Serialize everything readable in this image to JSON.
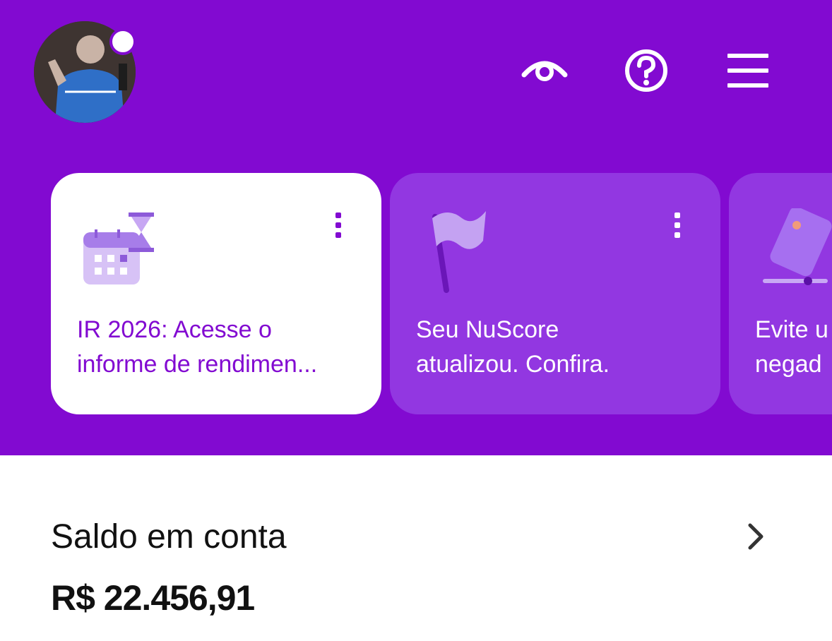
{
  "header": {
    "avatar_icon": "user-photo",
    "actions": [
      {
        "name": "eye-icon"
      },
      {
        "name": "help-icon"
      },
      {
        "name": "menu-icon"
      }
    ]
  },
  "cards": [
    {
      "text": "IR 2026: Acesse o\ninforme de rendimen...",
      "icon": "calendar-hourglass"
    },
    {
      "text": "Seu NuScore\natualizou. Confira.",
      "icon": "flag"
    },
    {
      "text": "Evite u\nnegad",
      "icon": "card"
    }
  ],
  "balance": {
    "title": "Saldo em conta",
    "value": "R$ 22.456,91"
  },
  "colors": {
    "brand": "#820ad1",
    "card_light": "#9237e1"
  }
}
